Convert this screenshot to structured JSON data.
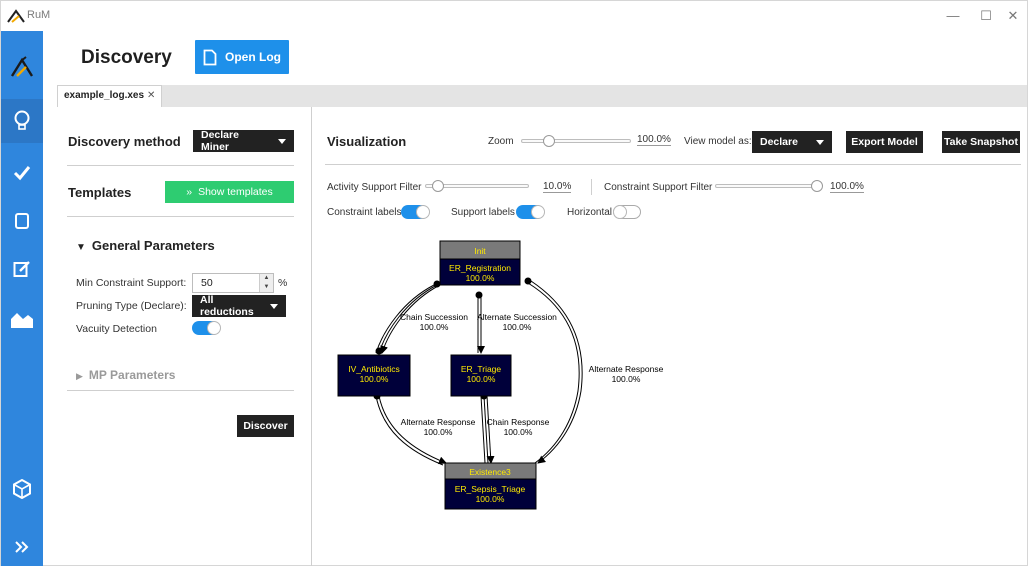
{
  "window": {
    "app_name": "RuM",
    "minimize": "—",
    "maximize": "☐",
    "close": "✕"
  },
  "sidebar": {
    "items": [
      {
        "icon": "rum-logo-icon"
      },
      {
        "icon": "bulb-icon",
        "active": true
      },
      {
        "icon": "checkmark-icon"
      },
      {
        "icon": "copy-icon"
      },
      {
        "icon": "edit-icon"
      },
      {
        "icon": "area-chart-icon"
      },
      {
        "icon": "cube-icon"
      },
      {
        "icon": "double-chevron-right-icon"
      }
    ]
  },
  "header": {
    "title": "Discovery",
    "open_log_label": "Open Log"
  },
  "tabs": [
    {
      "label": "example_log.xes",
      "close": "✕"
    }
  ],
  "left": {
    "discovery_method_label": "Discovery method",
    "discovery_method_value": "Declare Miner",
    "templates_label": "Templates",
    "show_templates_label": "Show templates",
    "general_params_label": "General Parameters",
    "min_support_label": "Min Constraint Support:",
    "min_support_value": "50",
    "min_support_unit": "%",
    "pruning_label": "Pruning Type (Declare):",
    "pruning_value": "All reductions",
    "vacuity_label": "Vacuity Detection",
    "vacuity_on": true,
    "mp_params_label": "MP Parameters",
    "discover_label": "Discover"
  },
  "viz": {
    "title": "Visualization",
    "zoom_label": "Zoom",
    "zoom_value": "100.0%",
    "view_model_label": "View model as:",
    "view_model_value": "Declare",
    "export_label": "Export Model",
    "snapshot_label": "Take Snapshot",
    "activity_filter_label": "Activity Support Filter",
    "activity_filter_value": "10.0%",
    "constraint_filter_label": "Constraint Support Filter",
    "constraint_filter_value": "100.0%",
    "constraint_labels_label": "Constraint labels",
    "constraint_labels_on": true,
    "support_labels_label": "Support labels",
    "support_labels_on": true,
    "horizontal_label": "Horizontal",
    "horizontal_on": false
  },
  "graph": {
    "colors": {
      "node_fill": "#00003a",
      "node_text": "#ffea00",
      "header_fill": "#7a7a7a"
    },
    "nodes": {
      "er_registration": {
        "header": "Init",
        "name": "ER_Registration",
        "support": "100.0%"
      },
      "iv_antibiotics": {
        "name": "IV_Antibiotics",
        "support": "100.0%"
      },
      "er_triage": {
        "name": "ER_Triage",
        "support": "100.0%"
      },
      "er_sepsis_triage": {
        "header": "Existence3",
        "name": "ER_Sepsis_Triage",
        "support": "100.0%"
      }
    },
    "edges": {
      "chain_succession": {
        "name": "Chain Succession",
        "support": "100.0%"
      },
      "alternate_succession": {
        "name": "Alternate Succession",
        "support": "100.0%"
      },
      "alternate_response_right": {
        "name": "Alternate Response",
        "support": "100.0%"
      },
      "alternate_response_left": {
        "name": "Alternate Response",
        "support": "100.0%"
      },
      "chain_response": {
        "name": "Chain Response",
        "support": "100.0%"
      }
    }
  }
}
